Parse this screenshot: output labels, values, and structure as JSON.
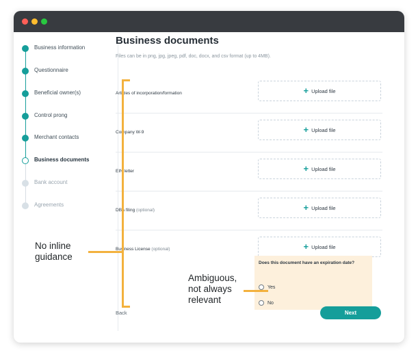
{
  "window": {
    "controls": [
      "close",
      "minimize",
      "maximize"
    ]
  },
  "stepper": {
    "steps": [
      {
        "label": "Business information",
        "state": "done"
      },
      {
        "label": "Questionnaire",
        "state": "done"
      },
      {
        "label": "Beneficial owner(s)",
        "state": "done"
      },
      {
        "label": "Control prong",
        "state": "done"
      },
      {
        "label": "Merchant contacts",
        "state": "done"
      },
      {
        "label": "Business documents",
        "state": "current"
      },
      {
        "label": "Bank account",
        "state": "todo"
      },
      {
        "label": "Agreements",
        "state": "todo"
      }
    ]
  },
  "main": {
    "title": "Business documents",
    "subtitle": "Files can be in png, jpg, jpeg, pdf, doc, docx, and csv format (up to 4MB).",
    "documents": [
      {
        "label": "Articles of incorporation/formation",
        "optional": "",
        "upload_label": "Upload file"
      },
      {
        "label": "Company W-9",
        "optional": "",
        "upload_label": "Upload file"
      },
      {
        "label": "EIN letter",
        "optional": "",
        "upload_label": "Upload file"
      },
      {
        "label": "DBA filing",
        "optional": "(optional)",
        "upload_label": "Upload file"
      },
      {
        "label": "Business License",
        "optional": "(optional)",
        "upload_label": "Upload file"
      }
    ],
    "expiry": {
      "question": "Does this document have an expiration date?",
      "options": [
        "Yes",
        "No"
      ]
    },
    "back_label": "Back",
    "next_label": "Next"
  },
  "annotations": {
    "left_note": "No inline guidance",
    "right_note": "Ambiguous, not always relevant"
  },
  "colors": {
    "accent": "#159e9a",
    "annotation": "#f3b13d",
    "titlebar": "#383b40",
    "expiry_bg": "#fdf0dc"
  }
}
